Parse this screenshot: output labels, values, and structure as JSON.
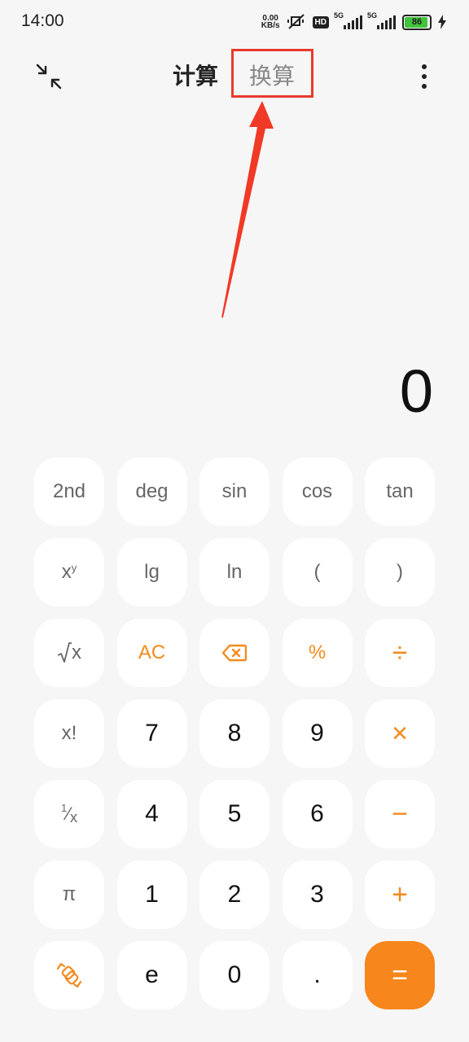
{
  "status_bar": {
    "time": "14:00",
    "net_speed_value": "0.00",
    "net_speed_unit": "KB/s",
    "hd_label": "HD",
    "signal1_label": "5G",
    "signal2_label": "5G",
    "battery_level": "86"
  },
  "header": {
    "tab_calculate": "计算",
    "tab_convert": "换算",
    "highlight_color": "#e83a2c"
  },
  "display": {
    "value": "0"
  },
  "keypad": {
    "row1": [
      "2nd",
      "deg",
      "sin",
      "cos",
      "tan"
    ],
    "row2": {
      "power_base": "x",
      "power_exp": "y",
      "lg": "lg",
      "ln": "ln",
      "open_paren": "(",
      "close_paren": ")"
    },
    "row3": {
      "sqrt_radicand": "x",
      "clear": "AC",
      "percent": "%",
      "divide": "÷"
    },
    "row4": {
      "factorial": "x!",
      "seven": "7",
      "eight": "8",
      "nine": "9",
      "multiply": "×"
    },
    "row5": {
      "recip_num": "1",
      "recip_den": "x",
      "four": "4",
      "five": "5",
      "six": "6",
      "minus": "−"
    },
    "row6": {
      "pi": "π",
      "one": "1",
      "two": "2",
      "three": "3",
      "plus": "+"
    },
    "row7": {
      "e": "e",
      "zero": "0",
      "dot": ".",
      "equals": "="
    }
  },
  "colors": {
    "accent": "#f38a1d",
    "equals_bg": "#f7861c",
    "key_bg": "#ffffff",
    "background": "#f6f6f6"
  },
  "icons": {
    "collapse": "collapse-arrows-icon",
    "menu": "more-vertical-icon",
    "backspace": "backspace-icon",
    "sqrt": "square-root-icon",
    "switch": "switch-mode-icon"
  }
}
